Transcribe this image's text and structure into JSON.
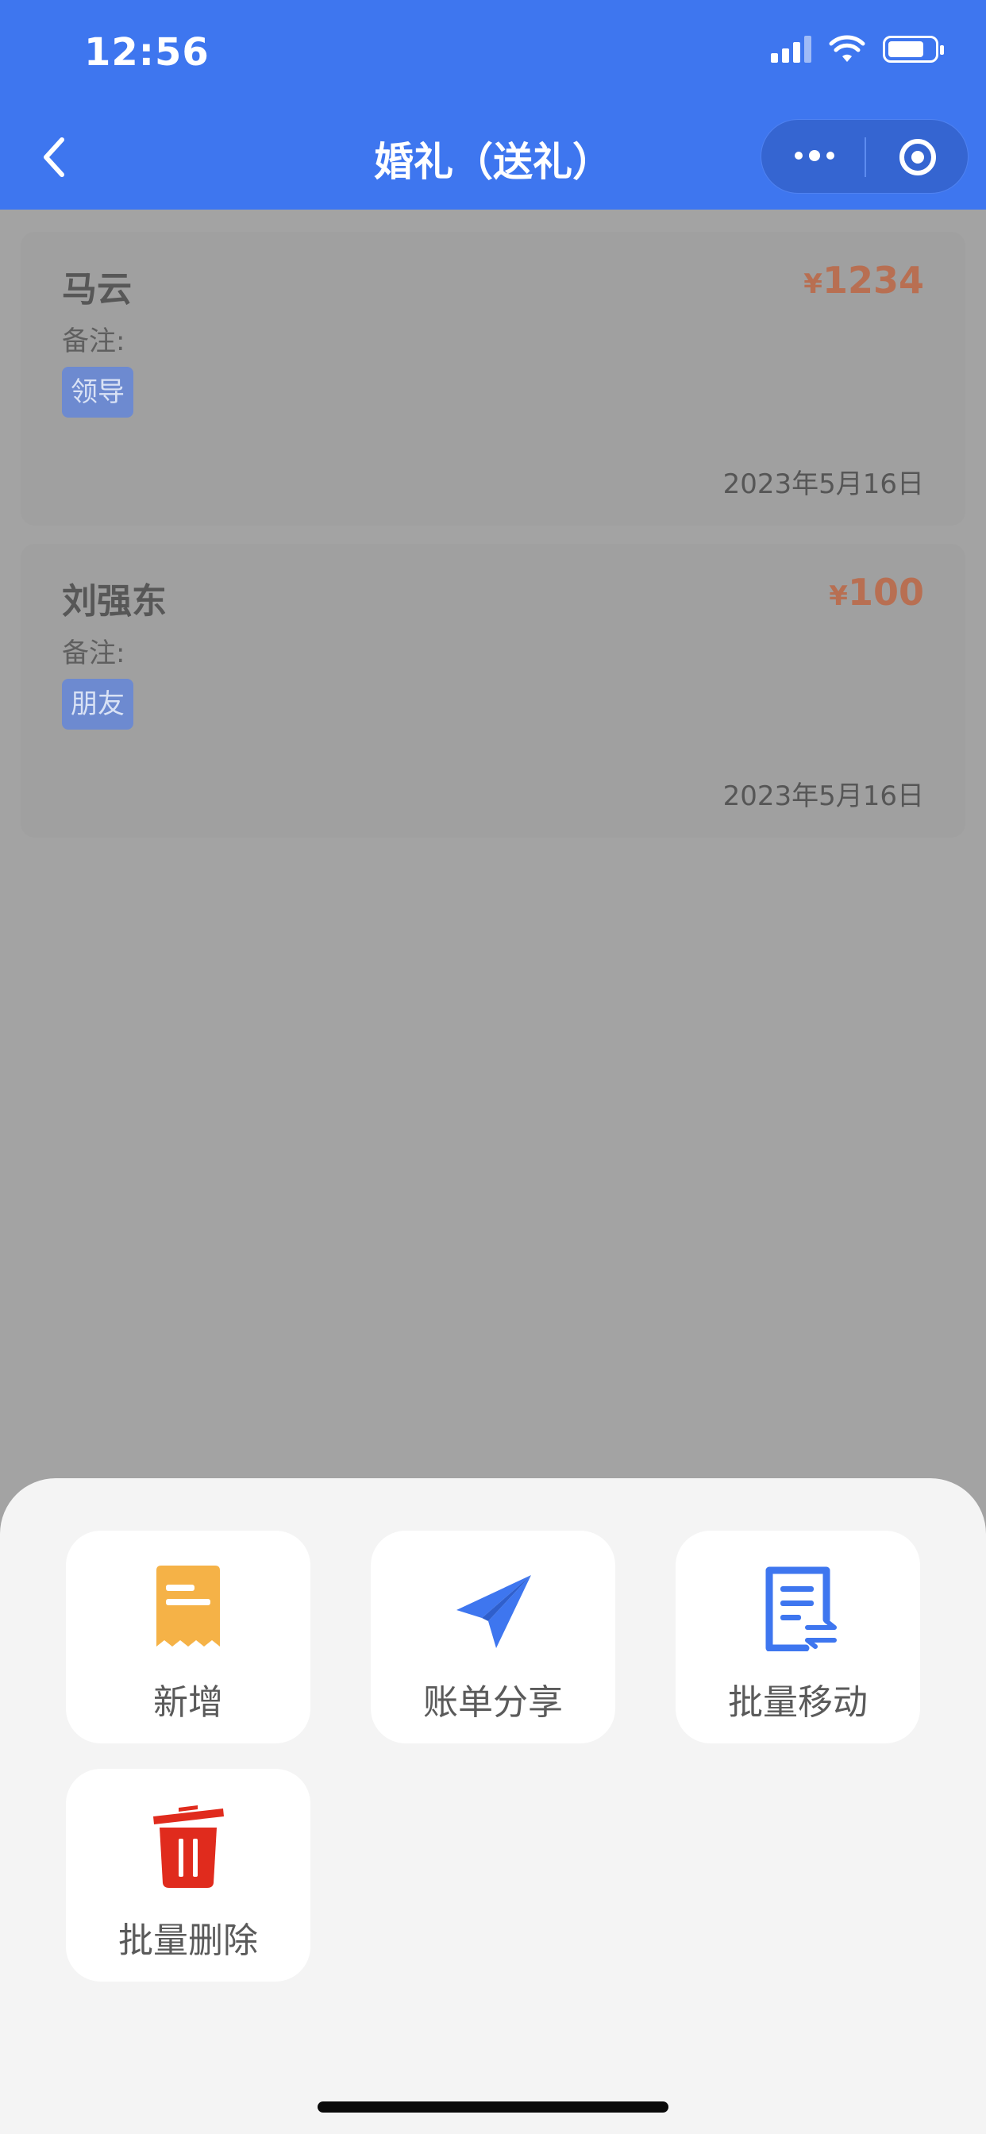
{
  "status_bar": {
    "time": "12:56"
  },
  "nav": {
    "title": "婚礼（送礼）"
  },
  "records": [
    {
      "name": "马云",
      "currency": "¥",
      "amount": "1234",
      "note_label": "备注:",
      "tag": "领导",
      "date": "2023年5月16日"
    },
    {
      "name": "刘强东",
      "currency": "¥",
      "amount": "100",
      "note_label": "备注:",
      "tag": "朋友",
      "date": "2023年5月16日"
    }
  ],
  "actions": [
    {
      "label": "新增",
      "icon": "receipt-icon",
      "color": "#f5b247"
    },
    {
      "label": "账单分享",
      "icon": "paper-plane-icon",
      "color": "#3e76ef"
    },
    {
      "label": "批量移动",
      "icon": "document-transfer-icon",
      "color": "#3e76ef"
    },
    {
      "label": "批量删除",
      "icon": "trash-icon",
      "color": "#e02b1d"
    }
  ],
  "colors": {
    "header": "#3e76ef",
    "overlay": "#a3a3a3",
    "amount": "#b86f52",
    "tag": "#6d8ad0"
  }
}
